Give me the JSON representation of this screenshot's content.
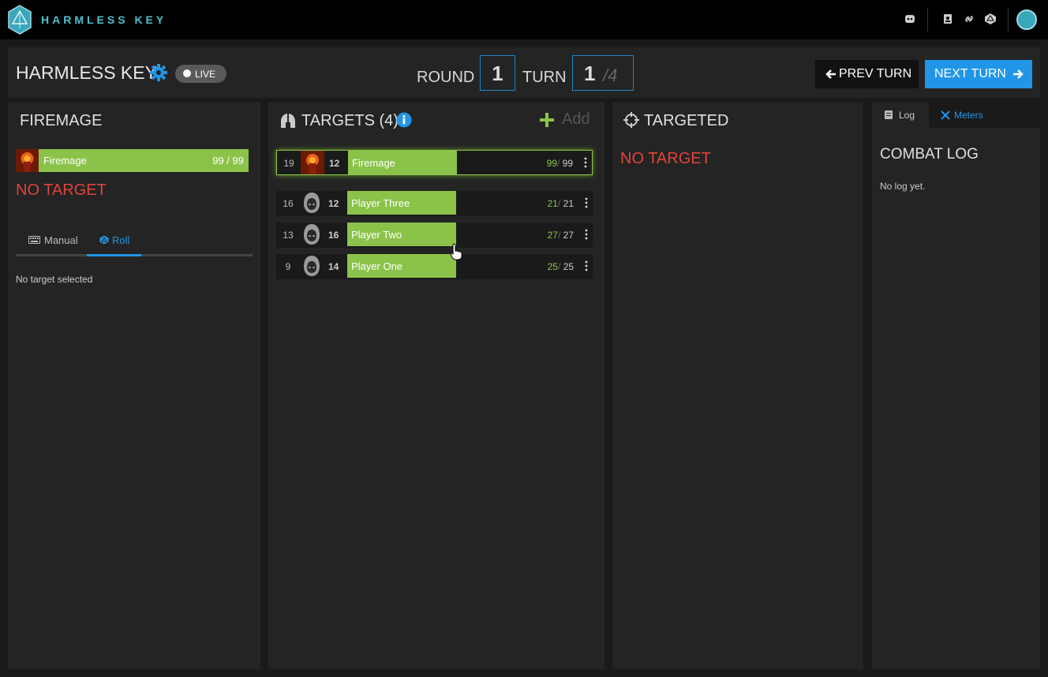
{
  "nav": {
    "brand": "HARMLESS KEY",
    "icons": [
      "discord-icon",
      "character-sheet-icon",
      "link-icon",
      "dice-icon",
      "user-avatar"
    ]
  },
  "header": {
    "campaign_title": "HARMLESS KEY",
    "live_label": "LIVE",
    "round_label": "ROUND",
    "round_value": "1",
    "turn_label": "TURN",
    "turn_current": "1",
    "turn_total": "/4",
    "prev_label": "PREV TURN",
    "next_label": "NEXT TURN"
  },
  "active_panel": {
    "title": "FIREMAGE",
    "entity_name": "Firemage",
    "entity_hp": "99 / 99",
    "no_target": "NO TARGET",
    "tabs": {
      "manual": "Manual",
      "roll": "Roll"
    },
    "no_target_selected": "No target selected"
  },
  "targets_panel": {
    "title": "TARGETS (4)",
    "add_label": "Add",
    "entities": [
      {
        "initiative": "19",
        "ac": "12",
        "name": "Firemage",
        "hp_current": "99",
        "hp_max": "99",
        "active": true,
        "avatar": "firemage-avatar"
      },
      {
        "initiative": "16",
        "ac": "12",
        "name": "Player Three",
        "hp_current": "21",
        "hp_max": "21",
        "active": false,
        "avatar": "hooded-player-avatar"
      },
      {
        "initiative": "13",
        "ac": "16",
        "name": "Player Two",
        "hp_current": "27",
        "hp_max": "27",
        "active": false,
        "avatar": "hooded-player-avatar"
      },
      {
        "initiative": "9",
        "ac": "14",
        "name": "Player One",
        "hp_current": "25",
        "hp_max": "25",
        "active": false,
        "avatar": "hooded-player-avatar"
      }
    ]
  },
  "targeted_panel": {
    "title": "TARGETED",
    "no_target": "NO TARGET"
  },
  "log_panel": {
    "tabs": {
      "log": "Log",
      "meters": "Meters"
    },
    "title": "COMBAT LOG",
    "empty_text": "No log yet."
  },
  "colors": {
    "accent_blue": "#2196e8",
    "hp_green": "#8bc34a",
    "danger_red": "#e0443b",
    "brand_teal": "#4ec0cf"
  }
}
